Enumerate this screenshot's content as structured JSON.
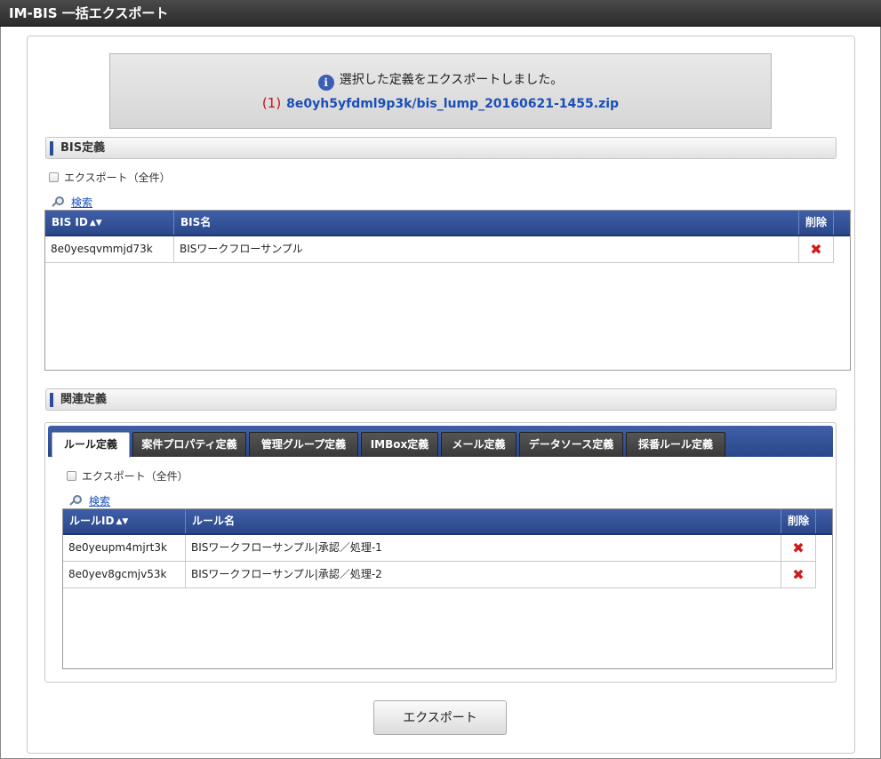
{
  "window": {
    "title": "IM-BIS 一括エクスポート"
  },
  "message": {
    "text": "選択した定義をエクスポートしました。",
    "annotation": "(1)",
    "file_link": "8e0yh5yfdml9p3k/bis_lump_20160621-1455.zip"
  },
  "bis_section": {
    "title": "BIS定義",
    "export_all_label": "エクスポート（全件）",
    "search_label": "検索",
    "columns": {
      "id": "BIS ID",
      "name": "BIS名",
      "delete": "削除"
    },
    "rows": [
      {
        "id": "8e0yesqvmmjd73k",
        "name": "BISワークフローサンプル"
      }
    ]
  },
  "related_section": {
    "title": "関連定義",
    "tabs": [
      {
        "label": "ルール定義"
      },
      {
        "label": "案件プロパティ定義"
      },
      {
        "label": "管理グループ定義"
      },
      {
        "label": "IMBox定義"
      },
      {
        "label": "メール定義"
      },
      {
        "label": "データソース定義"
      },
      {
        "label": "採番ルール定義"
      }
    ],
    "export_all_label": "エクスポート（全件）",
    "search_label": "検索",
    "columns": {
      "id": "ルールID",
      "name": "ルール名",
      "delete": "削除"
    },
    "rows": [
      {
        "id": "8e0yeupm4mjrt3k",
        "name": "BISワークフローサンプル|承認／処理-1"
      },
      {
        "id": "8e0yev8gcmjv53k",
        "name": "BISワークフローサンプル|承認／処理-2"
      }
    ]
  },
  "actions": {
    "export_label": "エクスポート"
  },
  "icons": {
    "info": "info-icon",
    "search": "search-icon",
    "delete": "delete-icon",
    "sort": "sort-icon"
  },
  "colors": {
    "header_blue": "#2d4c9a",
    "link_blue": "#1a4fb8",
    "annotation_red": "#cc1111",
    "delete_red": "#d01a1a"
  }
}
